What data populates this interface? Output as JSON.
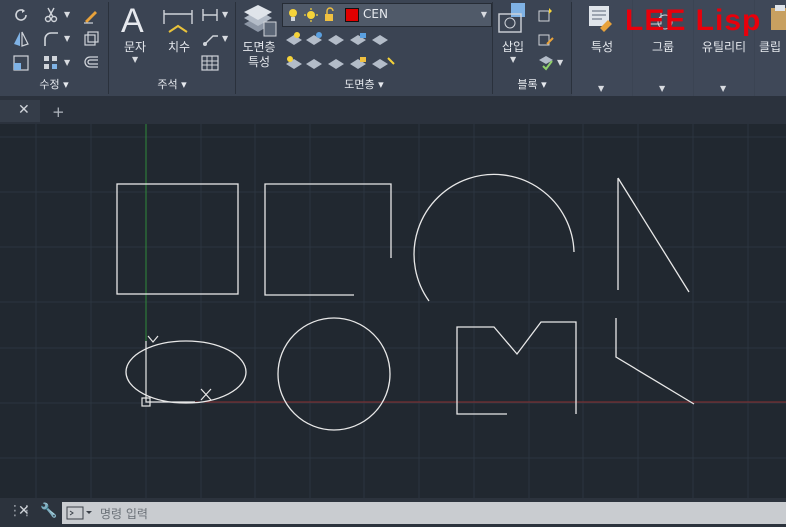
{
  "ribbon": {
    "panels": {
      "modify": "수정",
      "annotation": "주석",
      "layers": "도면층",
      "block": "블록"
    },
    "text_button": "문자",
    "dimension_button": "치수",
    "layer_props_line1": "도면층",
    "layer_props_line2": "특성",
    "insert_button": "삽입",
    "properties_button": "특성",
    "group_button": "그룹",
    "utilities_button": "유틸리티",
    "clipboard_button": "클립",
    "layer_combo": {
      "value": "CEN",
      "color": "#e00000"
    }
  },
  "overlay": {
    "brand": "LEE Lisp"
  },
  "command_line": {
    "placeholder": "명령 입력"
  },
  "colors": {
    "ribbon": "#3b4453",
    "canvas": "#212830",
    "grid": "#2c3540",
    "geometry": "#e8e8e8",
    "y_axis": "#2f8a3a",
    "x_axis": "#8a2f2f"
  }
}
